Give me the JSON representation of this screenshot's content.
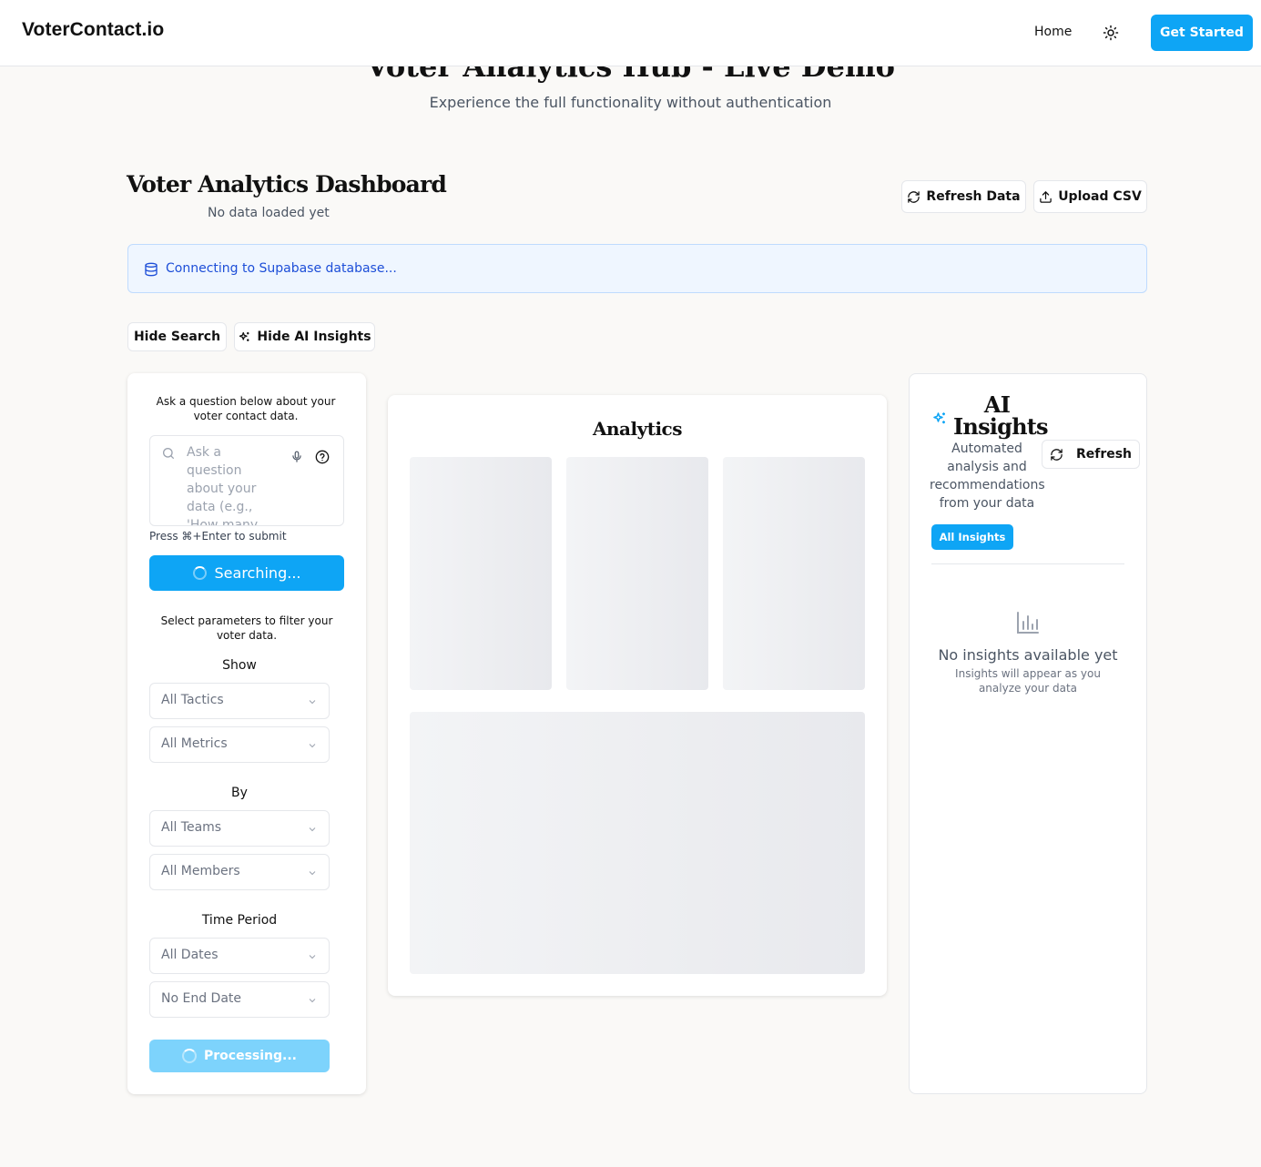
{
  "header": {
    "brand": "VoterContact.io",
    "nav_home": "Home",
    "cta": "Get Started"
  },
  "hero": {
    "title": "Voter Analytics Hub - Live Demo",
    "subtitle": "Experience the full functionality without authentication"
  },
  "dashboard": {
    "title": "Voter Analytics Dashboard",
    "status": "No data loaded yet",
    "refresh_label": "Refresh Data",
    "upload_label": "Upload CSV"
  },
  "alert": {
    "message": "Connecting to Supabase database..."
  },
  "toggles": {
    "hide_search": "Hide Search",
    "hide_ai": "Hide AI Insights"
  },
  "search_panel": {
    "intro": "Ask a question below about your voter contact data.",
    "placeholder": "Ask a question about your data (e.g., 'How many",
    "hint": "Press ⌘+Enter to submit",
    "button_label": "Searching..."
  },
  "filters": {
    "intro": "Select parameters to filter your voter data.",
    "show_label": "Show",
    "tactic": "All Tactics",
    "metric": "All Metrics",
    "by_label": "By",
    "team": "All Teams",
    "member": "All Members",
    "time_label": "Time Period",
    "start_date": "All Dates",
    "end_date": "No End Date",
    "submit_label": "Processing..."
  },
  "analytics": {
    "title": "Analytics"
  },
  "insights": {
    "title": "AI Insights",
    "description": "Automated analysis and recommendations from your data",
    "refresh_label": "Refresh",
    "tab_all": "All Insights",
    "empty_title": "No insights available yet",
    "empty_sub": "Insights will appear as you analyze your data"
  },
  "colors": {
    "primary": "#0ea5f5",
    "primary_disabled": "#7dd3fc",
    "alert_bg": "#eff6ff",
    "alert_text": "#1d4ed8",
    "page_bg": "#faf9f7"
  },
  "icons": {
    "theme": "sun-icon",
    "refresh": "refresh-icon",
    "upload": "upload-icon",
    "database": "database-icon",
    "sparkles": "sparkles-icon",
    "search": "search-icon",
    "mic": "mic-icon",
    "help": "help-circle-icon",
    "chevron": "chevron-down-icon",
    "empty": "bar-chart-icon"
  }
}
